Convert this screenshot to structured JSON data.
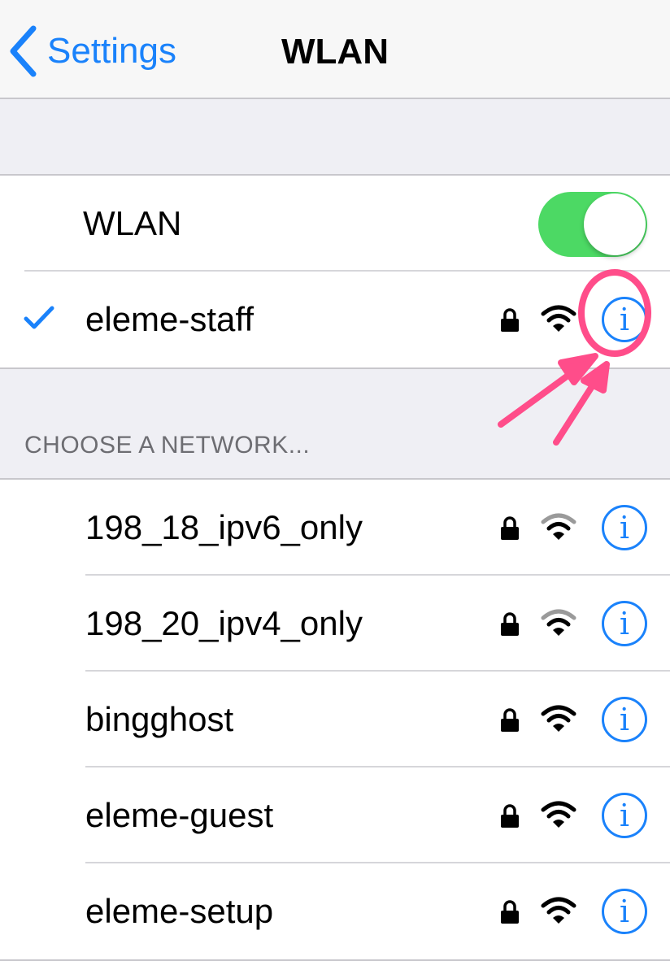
{
  "nav": {
    "back_label": "Settings",
    "title": "WLAN"
  },
  "wlan_toggle": {
    "label": "WLAN",
    "on": true
  },
  "connected_network": {
    "name": "eleme-staff",
    "secured": true,
    "signal_bars": 3,
    "info_glyph": "i"
  },
  "networks_section": {
    "header": "CHOOSE A NETWORK...",
    "items": [
      {
        "name": "198_18_ipv6_only",
        "secured": true,
        "signal_bars": 2,
        "info_glyph": "i"
      },
      {
        "name": "198_20_ipv4_only",
        "secured": true,
        "signal_bars": 2,
        "info_glyph": "i"
      },
      {
        "name": "bingghost",
        "secured": true,
        "signal_bars": 3,
        "info_glyph": "i"
      },
      {
        "name": "eleme-guest",
        "secured": true,
        "signal_bars": 3,
        "info_glyph": "i"
      },
      {
        "name": "eleme-setup",
        "secured": true,
        "signal_bars": 3,
        "info_glyph": "i"
      }
    ]
  },
  "colors": {
    "accent": "#1a82fb",
    "toggle_on": "#4cd964",
    "annotation": "#ff4d8a",
    "background": "#efeff4"
  },
  "icons": {
    "back": "chevron-left-icon",
    "check": "checkmark-icon",
    "lock": "lock-icon",
    "wifi": "wifi-icon",
    "info": "info-icon"
  }
}
